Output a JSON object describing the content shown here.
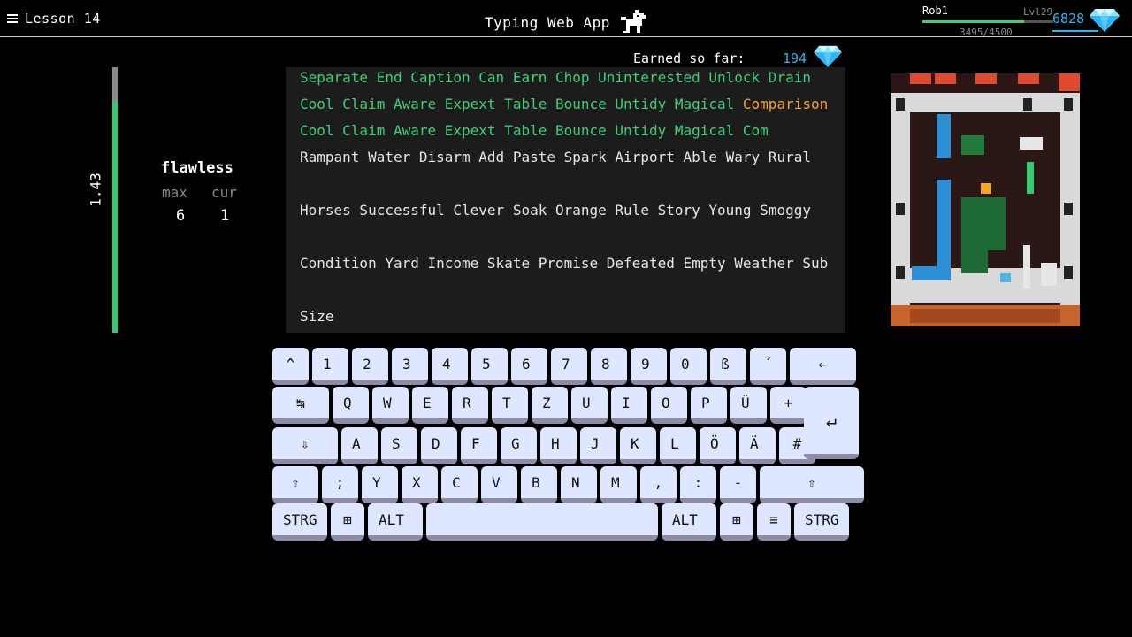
{
  "header": {
    "lesson_title": "Lesson 14",
    "app_title": "Typing Web App",
    "user": {
      "name": "Rob1",
      "level": "Lvl29",
      "xp_text": "3495/4500",
      "xp_progress": 0.777
    },
    "gems_total": "6828"
  },
  "stats": {
    "speed_value": "1.43",
    "speed_progress": 0.87,
    "combo_title": "flawless",
    "max_label": "max",
    "cur_label": "cur",
    "max_value": "6",
    "cur_value": "1"
  },
  "earned": {
    "label": "Earned so far:",
    "value": "194"
  },
  "text_lines": [
    {
      "typed": "Separate End Caption Can Earn Chop Uninterested Unlock Drain",
      "current": "",
      "pending": ""
    },
    {
      "typed": "Cool Claim Aware Expext Table Bounce Untidy Magical ",
      "current": "Comparison",
      "pending": ""
    },
    {
      "typed": "Cool Claim Aware Expext Table Bounce Untidy Magical Com",
      "current": "",
      "pending": ""
    },
    {
      "typed": "",
      "current": "",
      "pending": "Rampant Water Disarm Add Paste Spark Airport Able Wary Rural"
    },
    {
      "typed": "",
      "current": "",
      "pending": "Horses Successful Clever Soak Orange Rule Story Young Smoggy"
    },
    {
      "typed": "",
      "current": "",
      "pending": "Condition Yard Income Skate Promise Defeated Empty Weather Sub"
    },
    {
      "typed": "",
      "current": "",
      "pending": "Size"
    }
  ],
  "keyboard": {
    "row1": [
      "^",
      "1",
      "2",
      "3",
      "4",
      "5",
      "6",
      "7",
      "8",
      "9",
      "0",
      "ß",
      "´",
      "←"
    ],
    "row2": [
      "↹",
      "Q",
      "W",
      "E",
      "R",
      "T",
      "Z",
      "U",
      "I",
      "O",
      "P",
      "Ü",
      "+"
    ],
    "row3": [
      "⇩",
      "A",
      "S",
      "D",
      "F",
      "G",
      "H",
      "J",
      "K",
      "L",
      "Ö",
      "Ä",
      "#"
    ],
    "row4": [
      "⇧",
      ";",
      "Y",
      "X",
      "C",
      "V",
      "B",
      "N",
      "M",
      ",",
      ":",
      "-",
      "⇧"
    ],
    "row5": [
      "STRG",
      "⊞",
      "ALT",
      "",
      "ALT",
      "⊞",
      "≡",
      "STRG"
    ],
    "enter": "↵"
  },
  "colors": {
    "typed": "#3ccf7a",
    "current": "#f5a623",
    "gem": "#29b6f6",
    "key_face": "#dfe6ff",
    "key_shadow": "#8e8aa8"
  }
}
